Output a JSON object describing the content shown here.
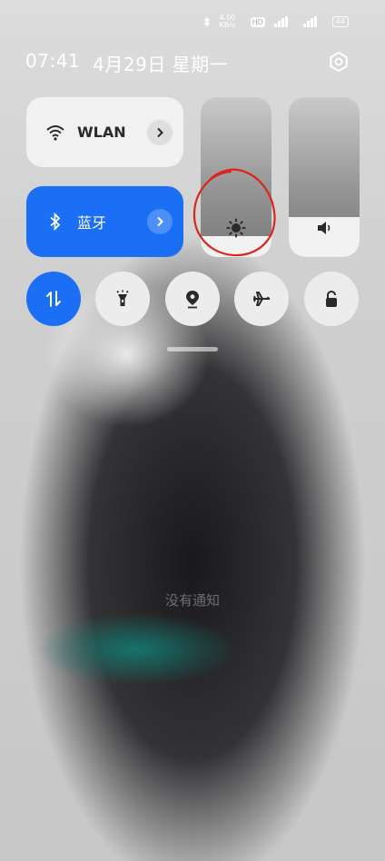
{
  "status_bar": {
    "bluetooth_icon": "bluetooth-icon",
    "network_speed": "4.00 KB/s",
    "hd_badge": "HD",
    "signal1": "signal-icon",
    "signal2": "signal-icon",
    "battery": "44"
  },
  "header": {
    "time": "07:41",
    "date": "4月29日 星期一",
    "settings_icon": "settings-icon"
  },
  "tiles": {
    "wlan": {
      "label": "WLAN",
      "icon": "wifi-icon"
    },
    "bluetooth": {
      "label": "蓝牙",
      "icon": "bluetooth-icon",
      "active": true
    }
  },
  "sliders": {
    "brightness": {
      "icon": "sun-icon",
      "level": 0.13
    },
    "volume": {
      "icon": "speaker-icon",
      "level": 0.25
    }
  },
  "quick_buttons": [
    {
      "name": "mobile-data",
      "icon": "data-arrows-icon",
      "active": true
    },
    {
      "name": "flashlight",
      "icon": "flashlight-icon",
      "active": false
    },
    {
      "name": "location",
      "icon": "location-icon",
      "active": false
    },
    {
      "name": "airplane-mode",
      "icon": "airplane-icon",
      "active": false
    },
    {
      "name": "screen-lock",
      "icon": "lock-icon",
      "active": false
    }
  ],
  "notifications": {
    "empty_text": "没有通知"
  },
  "colors": {
    "accent": "#1b6ff5",
    "annotation": "#d9261c"
  }
}
